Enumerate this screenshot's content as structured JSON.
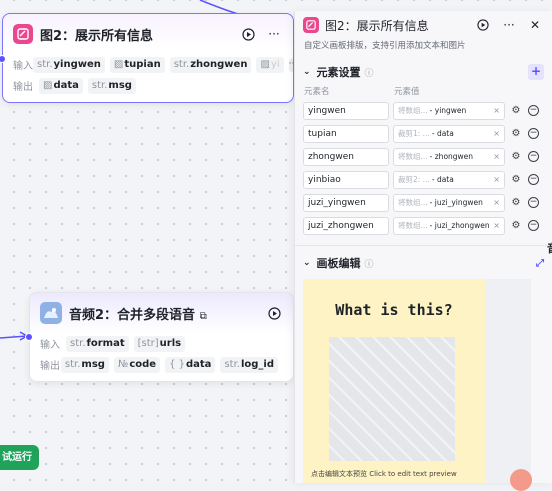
{
  "node_show": {
    "title": "图2：展示所有信息",
    "input_label": "输入",
    "output_label": "输出",
    "inputs": [
      {
        "prefix": "str.",
        "name": "yingwen"
      },
      {
        "prefix": "",
        "name": "tupian",
        "icon": "image-icon"
      },
      {
        "prefix": "str.",
        "name": "zhongwen"
      },
      {
        "prefix": "",
        "name": "yi",
        "icon": "image-icon",
        "faded": true
      }
    ],
    "more_label": "···",
    "outputs": [
      {
        "prefix": "",
        "name": "data",
        "icon": "image-icon"
      },
      {
        "prefix": "str.",
        "name": "msg"
      }
    ]
  },
  "node_audio": {
    "title": "音频2：合并多段语音",
    "input_label": "输入",
    "output_label": "输出",
    "inputs": [
      {
        "prefix": "str.",
        "name": "format"
      },
      {
        "prefix": "[str]",
        "name": "urls"
      }
    ],
    "outputs": [
      {
        "prefix": "str.",
        "name": "msg"
      },
      {
        "prefix": "№",
        "name": "code"
      },
      {
        "prefix": "{ }",
        "name": "data"
      },
      {
        "prefix": "str.",
        "name": "log_id"
      }
    ]
  },
  "panel": {
    "title": "图2：展示所有信息",
    "description": "自定义画板排版，支持引用添加文本和图片",
    "elements_title": "元素设置",
    "col_name": "元素名",
    "col_value": "元素值",
    "elements": [
      {
        "name": "yingwen",
        "source": "将数组...",
        "var": "yingwen"
      },
      {
        "name": "tupian",
        "source": "裁剪1: ...",
        "var": "data"
      },
      {
        "name": "zhongwen",
        "source": "将数组...",
        "var": "zhongwen"
      },
      {
        "name": "yinbiao",
        "source": "裁剪2: ...",
        "var": "data"
      },
      {
        "name": "juzi_yingwen",
        "source": "将数组...",
        "var": "juzi_yingwen"
      },
      {
        "name": "juzi_zhongwen",
        "source": "将数组...",
        "var": "juzi_zhongwen"
      }
    ],
    "canvas_title": "画板编辑",
    "preview_heading": "What is this?",
    "preview_footer": "点击编辑文本预览 Click to edit text preview"
  },
  "run_button": "试运行",
  "right_cut_text": "音",
  "colors": {
    "accent": "#5a52ff",
    "run": "#1fa25a",
    "preview_bg": "#fdf3c4",
    "node_icon": "#e9488f"
  }
}
